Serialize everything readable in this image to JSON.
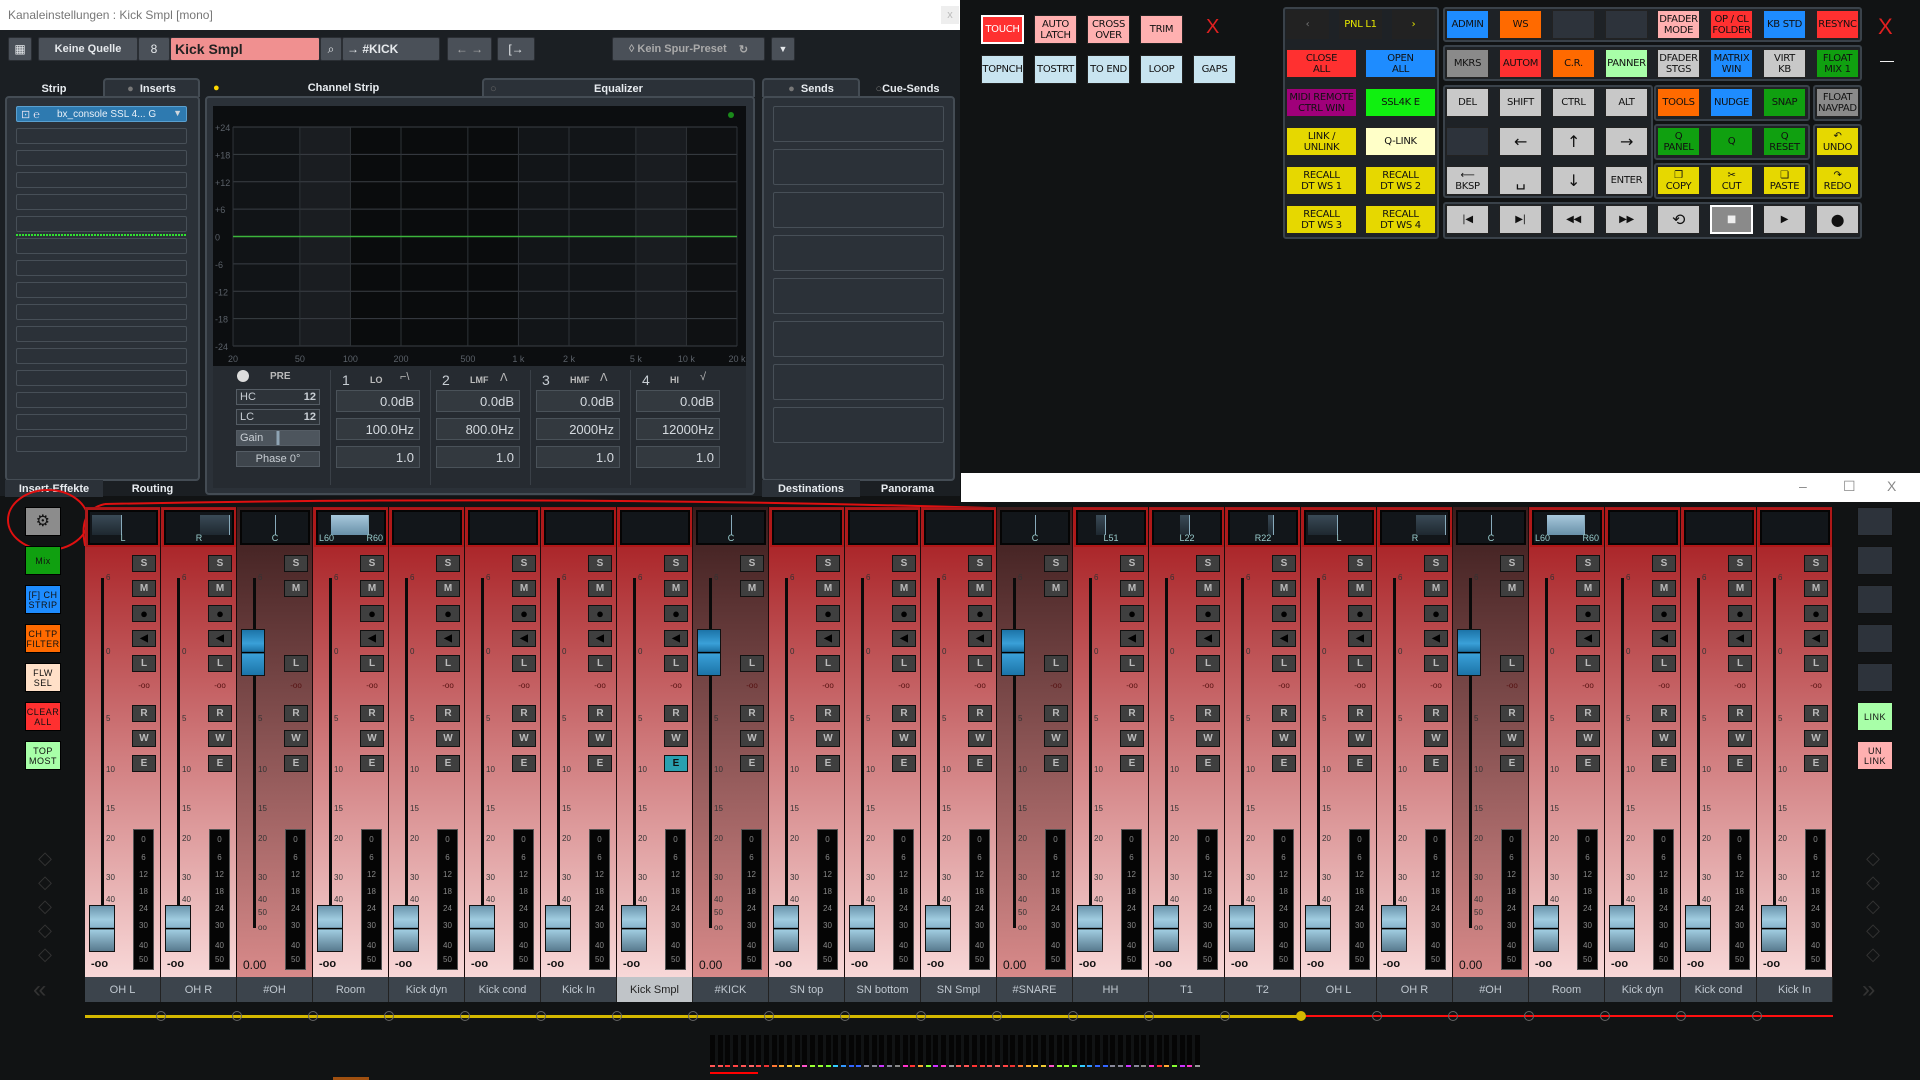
{
  "channel_window": {
    "title": "Kanaleinstellungen : Kick Smpl [mono]",
    "close_label": "x",
    "toolbar": {
      "input_source": "Keine Quelle",
      "channel_number": "8",
      "channel_name": "Kick Smpl",
      "output_route": "#KICK",
      "preset": "Kein Spur-Preset"
    },
    "tabs": {
      "strip": "Strip",
      "inserts": "Inserts",
      "channel_strip": "Channel Strip",
      "equalizer": "Equalizer",
      "sends": "Sends",
      "cue_sends": "Cue-Sends"
    },
    "inserts": {
      "slots": [
        "bx_console SSL 4... G",
        "",
        "",
        "",
        "",
        "",
        "",
        "",
        "",
        "",
        "",
        "",
        "",
        "",
        "",
        ""
      ]
    },
    "bottom_tabs": {
      "insert_effects": "Insert-Effekte",
      "routing": "Routing",
      "destinations": "Destinations",
      "panorama": "Panorama"
    },
    "eq": {
      "db_labels": [
        "+24",
        "+18",
        "+12",
        "+6",
        "0",
        "-6",
        "-12",
        "-18",
        "-24"
      ],
      "freq_labels": [
        {
          "f": 20,
          "t": "20"
        },
        {
          "f": 50,
          "t": "50"
        },
        {
          "f": 100,
          "t": "100"
        },
        {
          "f": 200,
          "t": "200"
        },
        {
          "f": 500,
          "t": "500"
        },
        {
          "f": 1000,
          "t": "1 k"
        },
        {
          "f": 2000,
          "t": "2 k"
        },
        {
          "f": 5000,
          "t": "5 k"
        },
        {
          "f": 10000,
          "t": "10 k"
        },
        {
          "f": 20000,
          "t": "20 k"
        }
      ],
      "curve_gain_db": 0,
      "curve_color": "#3cb43c",
      "pre_label": "PRE",
      "hc_label": "HC",
      "hc_value": "12",
      "lc_label": "LC",
      "lc_value": "12",
      "gain_label": "Gain",
      "phase_label": "Phase 0°",
      "bands": [
        {
          "num": "1",
          "name": "LO",
          "shape": "⌐\\",
          "gain": "0.0dB",
          "freq": "100.0Hz",
          "q": "1.0"
        },
        {
          "num": "2",
          "name": "LMF",
          "shape": "ᐱ",
          "gain": "0.0dB",
          "freq": "800.0Hz",
          "q": "1.0"
        },
        {
          "num": "3",
          "name": "HMF",
          "shape": "ᐱ",
          "gain": "0.0dB",
          "freq": "2000Hz",
          "q": "1.0"
        },
        {
          "num": "4",
          "name": "HI",
          "shape": "√",
          "gain": "0.0dB",
          "freq": "12000Hz",
          "q": "1.0"
        }
      ]
    },
    "sends": {
      "slots": [
        "",
        "",
        "",
        "",
        "",
        "",
        "",
        ""
      ]
    }
  },
  "automation_panel": {
    "row1": [
      {
        "label": "TOUCH",
        "color": "#ff3030",
        "text": "#fff",
        "active": true
      },
      {
        "label": "AUTO\nLATCH",
        "color": "#ffb0b0"
      },
      {
        "label": "CROSS\nOVER",
        "color": "#ffb0b0"
      },
      {
        "label": "TRIM",
        "color": "#ffb0b0"
      }
    ],
    "close_label": "X",
    "row2": [
      {
        "label": "TOPNCH",
        "color": "#c8e4f0"
      },
      {
        "label": "TOSTRT",
        "color": "#c8e4f0"
      },
      {
        "label": "TO END",
        "color": "#c8e4f0"
      },
      {
        "label": "LOOP",
        "color": "#c8e4f0"
      },
      {
        "label": "GAPS",
        "color": "#c8e4f0"
      }
    ]
  },
  "control_panel": {
    "nav": [
      {
        "label": "‹",
        "color": "#222",
        "text": "#777"
      },
      {
        "label": "PNL L1",
        "color": "#222",
        "text": "#e6e600"
      },
      {
        "label": "›",
        "color": "#222",
        "text": "#e6e600"
      }
    ],
    "left_rows": [
      [
        {
          "label": "CLOSE\nALL",
          "color": "#ff3030"
        },
        {
          "label": "OPEN\nALL",
          "color": "#1e8cff"
        }
      ],
      [
        {
          "label": "MIDI REMOTE\nCTRL WIN",
          "color": "#a0007a"
        },
        {
          "label": "SSL4K E",
          "color": "#10f010"
        }
      ],
      [
        {
          "label": "LINK /\nUNLINK",
          "color": "#e6d800"
        },
        {
          "label": "Q-LINK",
          "color": "#ffffc8"
        }
      ],
      [
        {
          "label": "RECALL\nDT WS 1",
          "color": "#e6d800"
        },
        {
          "label": "RECALL\nDT WS 2",
          "color": "#e6d800"
        }
      ],
      [
        {
          "label": "RECALL\nDT WS 3",
          "color": "#e6d800"
        },
        {
          "label": "RECALL\nDT WS 4",
          "color": "#e6d800"
        }
      ]
    ],
    "right_rows": [
      [
        {
          "label": "ADMIN",
          "color": "#1e8cff"
        },
        {
          "label": "WS",
          "color": "#ff6a00"
        },
        {
          "label": "",
          "color": "#2d333b"
        },
        {
          "label": "",
          "color": "#2d333b"
        },
        {
          "label": "DFADER\nMODE",
          "color": "#ffb0b0"
        },
        {
          "label": "OP / CL\nFOLDER",
          "color": "#ff3030"
        },
        {
          "label": "KB STD",
          "color": "#1e8cff"
        },
        {
          "label": "RESYNC",
          "color": "#ff3030"
        }
      ],
      [
        {
          "label": "MKRS",
          "color": "#8a8a8a"
        },
        {
          "label": "AUTOM",
          "color": "#ff3030"
        },
        {
          "label": "C.R.",
          "color": "#ff6a00"
        },
        {
          "label": "PANNER",
          "color": "#a8ffa8"
        },
        {
          "label": "DFADER\nSTGS",
          "color": "#c8c8c8"
        },
        {
          "label": "MATRIX\nWIN",
          "color": "#1e8cff"
        },
        {
          "label": "VIRT\nKB",
          "color": "#c8c8c8"
        },
        {
          "label": "FLOAT\nMIX 1",
          "color": "#10a010"
        }
      ],
      [
        {
          "label": "DEL",
          "color": "#c8c8c8"
        },
        {
          "label": "SHIFT",
          "color": "#c8c8c8"
        },
        {
          "label": "CTRL",
          "color": "#c8c8c8"
        },
        {
          "label": "ALT",
          "color": "#c8c8c8"
        },
        {
          "label": "TOOLS",
          "color": "#ff6a00"
        },
        {
          "label": "NUDGE",
          "color": "#1e8cff"
        },
        {
          "label": "SNAP",
          "color": "#10a010"
        },
        {
          "label": "FLOAT\nNAVPAD",
          "color": "#8a8a8a"
        }
      ],
      [
        {
          "label": "",
          "color": "#2d333b"
        },
        {
          "label": "←",
          "color": "#c8c8c8",
          "big": true
        },
        {
          "label": "↑",
          "color": "#c8c8c8",
          "big": true
        },
        {
          "label": "→",
          "color": "#c8c8c8",
          "big": true
        },
        {
          "label": "Q\nPANEL",
          "color": "#10a010"
        },
        {
          "label": "Q",
          "color": "#10a010"
        },
        {
          "label": "Q\nRESET",
          "color": "#10a010"
        },
        {
          "label": "↶\nUNDO",
          "color": "#e6d800"
        }
      ],
      [
        {
          "label": "⟵\nBKSP",
          "color": "#c8c8c8"
        },
        {
          "label": "␣",
          "color": "#c8c8c8",
          "big": true
        },
        {
          "label": "↓",
          "color": "#c8c8c8",
          "big": true
        },
        {
          "label": "ENTER",
          "color": "#c8c8c8"
        },
        {
          "label": "❐\nCOPY",
          "color": "#e6d800"
        },
        {
          "label": "✂\nCUT",
          "color": "#e6d800"
        },
        {
          "label": "❏\nPASTE",
          "color": "#e6d800"
        },
        {
          "label": "↷\nREDO",
          "color": "#e6d800"
        }
      ],
      [
        {
          "label": "|◀",
          "color": "#c8c8c8"
        },
        {
          "label": "▶|",
          "color": "#c8c8c8"
        },
        {
          "label": "◀◀",
          "color": "#c8c8c8"
        },
        {
          "label": "▶▶",
          "color": "#c8c8c8"
        },
        {
          "label": "⟲",
          "color": "#c8c8c8",
          "big": true
        },
        {
          "label": "■",
          "color": "#8a8a8a",
          "text": "#eee",
          "active": true
        },
        {
          "label": "▶",
          "color": "#c8c8c8"
        },
        {
          "label": "●",
          "color": "#c8c8c8",
          "big": true
        }
      ]
    ],
    "close_label": "X",
    "minimize_label": "—"
  },
  "mixer": {
    "window_controls": {
      "minimize": "–",
      "maximize": "☐",
      "close": "X"
    },
    "left_sidebar": [
      {
        "label": "⚙",
        "color": "#8c8c8c",
        "icon": "gear-icon"
      },
      {
        "label": "Mix",
        "color": "#10a010"
      },
      {
        "label": "[F] CH\nSTRIP",
        "color": "#1e8cff"
      },
      {
        "label": "CH TP\nFILTER",
        "color": "#ff6a00"
      },
      {
        "label": "FLW\nSEL",
        "color": "#ffe0c8"
      },
      {
        "label": "CLEAR\nALL",
        "color": "#ff3030"
      },
      {
        "label": "TOP\nMOST",
        "color": "#a8ffa8"
      }
    ],
    "right_sidebar": [
      {
        "label": "",
        "color": "#2d333b"
      },
      {
        "label": "",
        "color": "#2d333b"
      },
      {
        "label": "",
        "color": "#2d333b"
      },
      {
        "label": "",
        "color": "#2d333b"
      },
      {
        "label": "",
        "color": "#2d333b"
      },
      {
        "label": "LINK",
        "color": "#a8ffa8"
      },
      {
        "label": "UN\nLINK",
        "color": "#ffb0b0"
      }
    ],
    "scroll_left": "«",
    "scroll_right": "»",
    "strip_buttons": {
      "solo": "S",
      "mute": "M",
      "record": "●",
      "listen": "◀",
      "read": "R",
      "write": "W",
      "edit": "E",
      "l": "L"
    },
    "fader_scale": [
      "6",
      "0",
      "5",
      "10",
      "15",
      "20",
      "30",
      "40",
      "50",
      "oo"
    ],
    "meter_scale": [
      "0",
      "6",
      "12",
      "18",
      "24",
      "30",
      "40",
      "50"
    ],
    "channels": [
      {
        "name": "OH L",
        "pan": "L",
        "pan_l": "",
        "pan_r": "",
        "group": false,
        "value": "-oo",
        "send": "-oo"
      },
      {
        "name": "OH R",
        "pan": "R",
        "group": false,
        "value": "-oo",
        "send": "-oo"
      },
      {
        "name": "#OH",
        "pan": "C",
        "group": true,
        "value": "0.00",
        "send": "-oo"
      },
      {
        "name": "Room",
        "pan": "",
        "pan_l": "L60",
        "pan_r": "R60",
        "group": false,
        "value": "-oo",
        "send": "-oo"
      },
      {
        "name": "Kick dyn",
        "pan": "",
        "group": false,
        "value": "-oo",
        "send": "-oo"
      },
      {
        "name": "Kick cond",
        "pan": "",
        "group": false,
        "value": "-oo",
        "send": "-oo"
      },
      {
        "name": "Kick In",
        "pan": "",
        "group": false,
        "value": "-oo",
        "send": "-oo"
      },
      {
        "name": "Kick Smpl",
        "pan": "",
        "group": false,
        "value": "-oo",
        "send": "-oo",
        "selected": true,
        "edit_active": true
      },
      {
        "name": "#KICK",
        "pan": "C",
        "group": true,
        "value": "0.00",
        "send": "-oo"
      },
      {
        "name": "SN top",
        "pan": "",
        "group": false,
        "value": "-oo",
        "send": "-oo"
      },
      {
        "name": "SN bottom",
        "pan": "",
        "group": false,
        "value": "-oo",
        "send": "-oo"
      },
      {
        "name": "SN Smpl",
        "pan": "",
        "group": false,
        "value": "-oo",
        "send": "-oo"
      },
      {
        "name": "#SNARE",
        "pan": "C",
        "group": true,
        "value": "0.00",
        "send": "-oo"
      },
      {
        "name": "HH",
        "pan": "L51",
        "group": false,
        "value": "-oo",
        "send": "-oo"
      },
      {
        "name": "T1",
        "pan": "L22",
        "group": false,
        "value": "-oo",
        "send": "-oo"
      },
      {
        "name": "T2",
        "pan": "R22",
        "group": false,
        "value": "-oo",
        "send": "-oo"
      },
      {
        "name": "OH L",
        "pan": "L",
        "group": false,
        "value": "-oo",
        "send": "-oo"
      },
      {
        "name": "OH R",
        "pan": "R",
        "group": false,
        "value": "-oo",
        "send": "-oo"
      },
      {
        "name": "#OH",
        "pan": "C",
        "group": true,
        "value": "0.00",
        "send": "-oo"
      },
      {
        "name": "Room",
        "pan": "",
        "pan_l": "L60",
        "pan_r": "R60",
        "group": false,
        "value": "-oo",
        "send": "-oo"
      },
      {
        "name": "Kick dyn",
        "pan": "",
        "group": false,
        "value": "-oo",
        "send": "-oo"
      },
      {
        "name": "Kick cond",
        "pan": "",
        "group": false,
        "value": "-oo",
        "send": "-oo"
      },
      {
        "name": "Kick In",
        "pan": "",
        "group": false,
        "value": "-oo",
        "send": "-oo"
      }
    ],
    "link_bar": {
      "linked_count": 16,
      "linked_color": "#d4b800",
      "unlinked_color": "#ff1010"
    },
    "colors": {
      "strip_top": "#a4161a",
      "strip_bottom": "#f8d8d8",
      "group_top": "#3a1c1c",
      "group_bottom": "#d88a8a"
    }
  }
}
